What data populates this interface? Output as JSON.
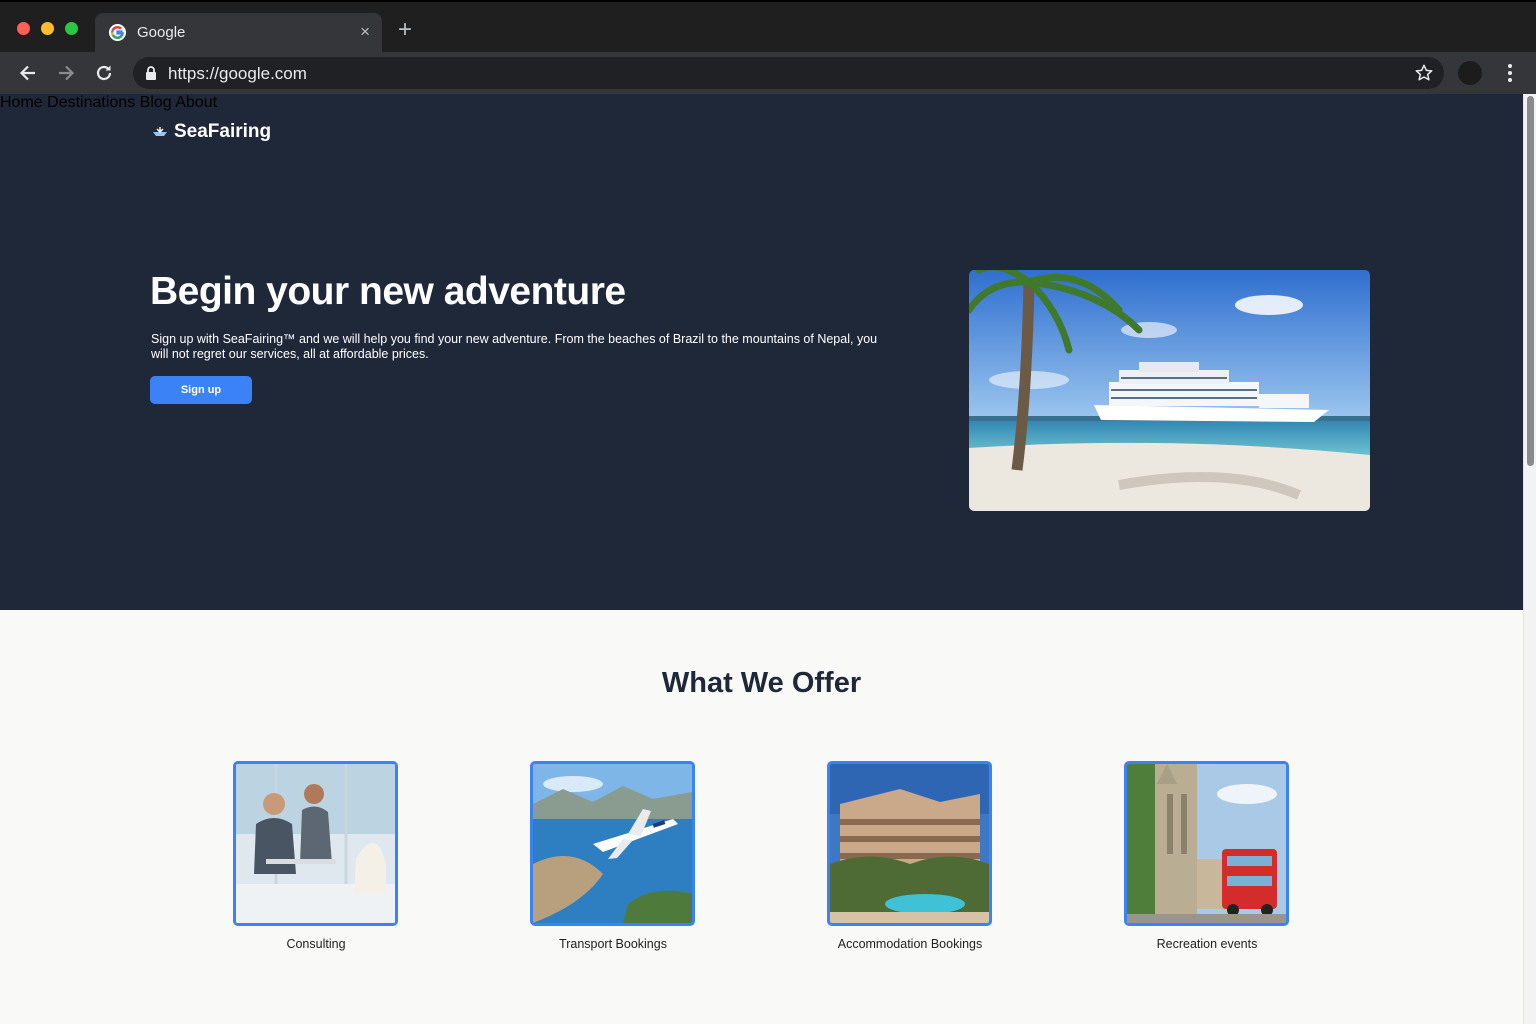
{
  "browser": {
    "tab_title": "Google",
    "url": "https://google.com",
    "new_tab_symbol": "+",
    "close_symbol": "×"
  },
  "site": {
    "brand": "SeaFairing",
    "brand_icon": "ship-icon",
    "nav": [
      "Home",
      "Destinations",
      "Blog",
      "About"
    ]
  },
  "hero": {
    "title": "Begin your new adventure",
    "text": "Sign up with SeaFairing™ and we will help you find your new adventure. From the beaches of Brazil to the mountains of Nepal, you will not regret our services, all at affordable prices.",
    "button": "Sign up"
  },
  "offers": {
    "title": "What We Offer",
    "items": [
      {
        "label": "Consulting"
      },
      {
        "label": "Transport Bookings"
      },
      {
        "label": "Accommodation Bookings"
      },
      {
        "label": "Recreation events"
      }
    ]
  },
  "colors": {
    "hero_bg": "#1f2839",
    "accent": "#3b82f6",
    "page_bg": "#f9f9f7"
  }
}
